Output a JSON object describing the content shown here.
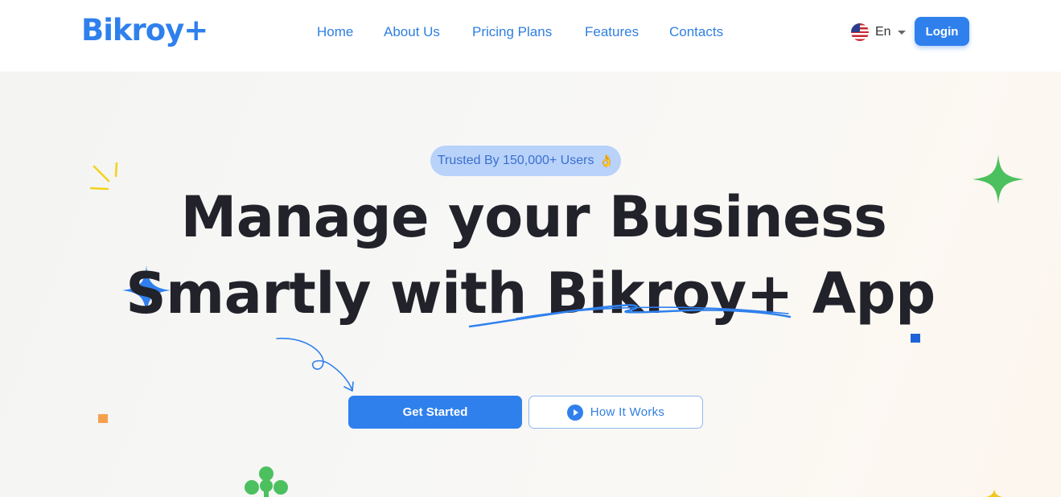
{
  "brand": {
    "logo": "Bikroy+"
  },
  "nav": {
    "items": [
      "Home",
      "About Us",
      "Pricing Plans",
      "Features",
      "Contacts"
    ]
  },
  "language": {
    "label": "En",
    "flag_icon": "us-flag-icon"
  },
  "header": {
    "login_label": "Login"
  },
  "hero": {
    "badge_text": "Trusted By 150,000+ Users",
    "badge_emoji": "👌",
    "headline_line1": "Manage your Business",
    "headline_line2": "Smartly with Bikroy+ App",
    "primary_cta": "Get Started",
    "secondary_cta": "How It Works"
  },
  "colors": {
    "brand_blue": "#2f80ed",
    "headline": "#22222b",
    "badge_bg": "#b8d2fa",
    "sparkle_green": "#4cc05f",
    "accent_yellow": "#f2d31b",
    "accent_orange": "#f6a04d"
  }
}
